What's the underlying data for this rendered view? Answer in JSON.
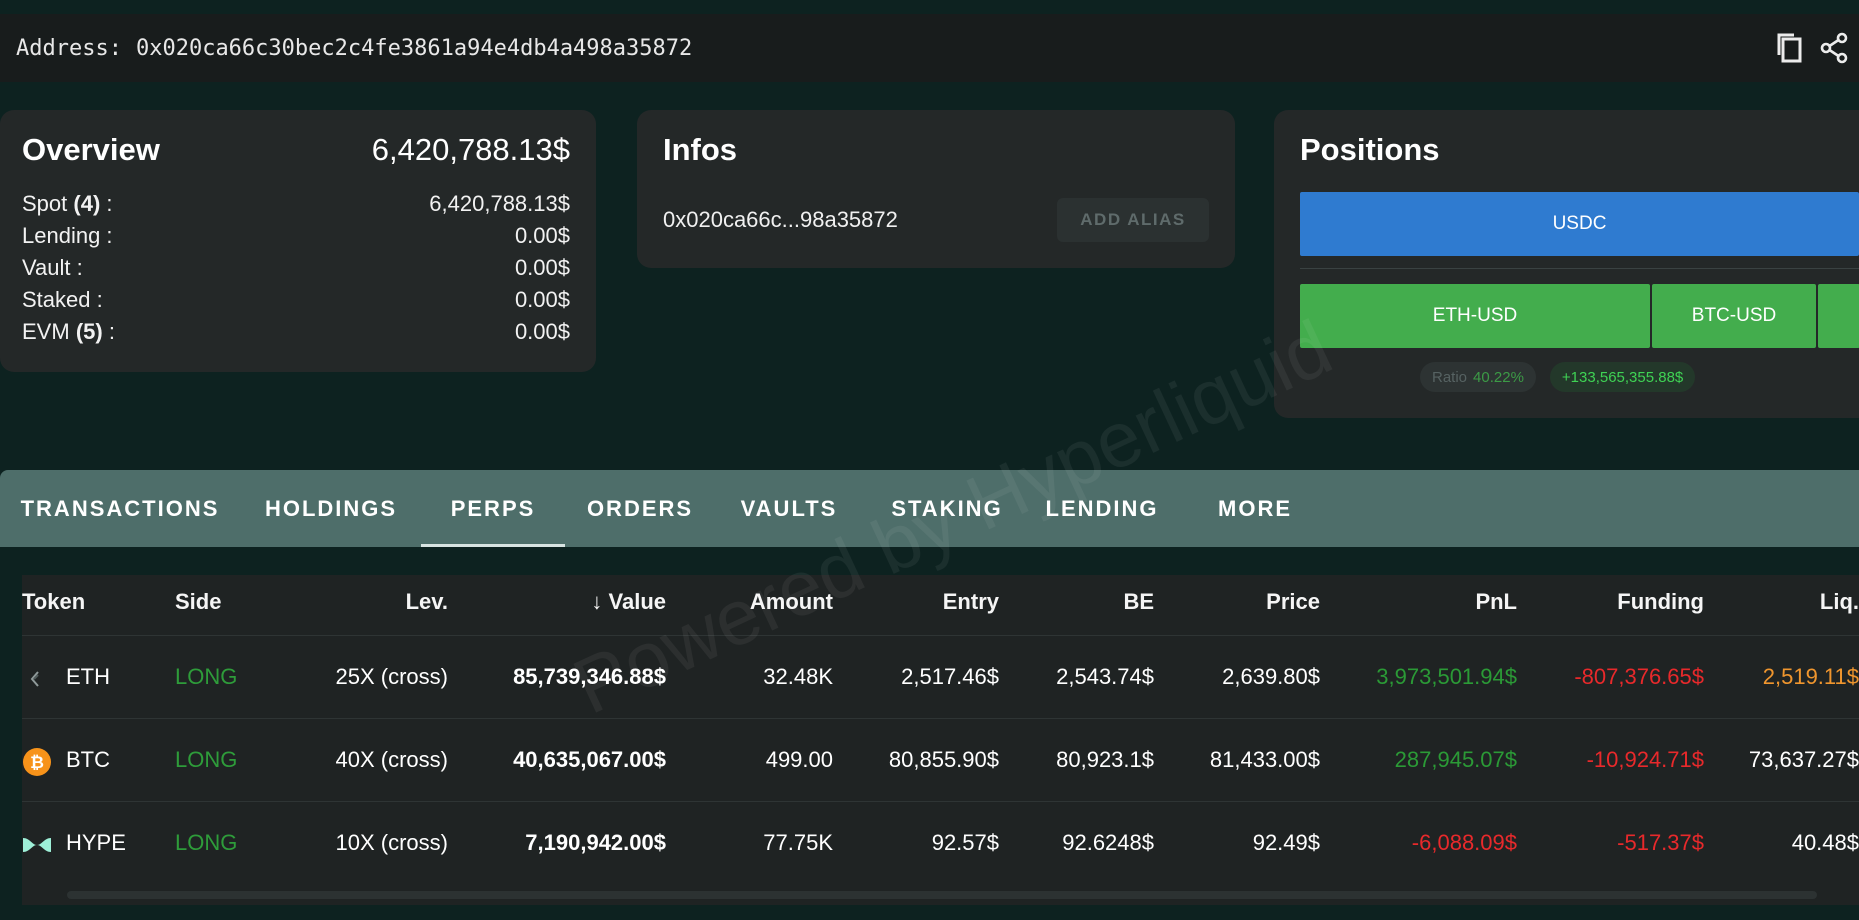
{
  "address_bar": {
    "label": "Address:",
    "value": "0x020ca66c30bec2c4fe3861a94e4db4a498a35872",
    "copy_icon": "copy-icon",
    "share_icon": "share-icon"
  },
  "overview": {
    "title": "Overview",
    "total": "6,420,788.13$",
    "rows": [
      {
        "label": "Spot",
        "count": "(4)",
        "suffix": " :",
        "value": "6,420,788.13$"
      },
      {
        "label": "Lending :",
        "count": "",
        "suffix": "",
        "value": "0.00$"
      },
      {
        "label": "Vault :",
        "count": "",
        "suffix": "",
        "value": "0.00$"
      },
      {
        "label": "Staked :",
        "count": "",
        "suffix": "",
        "value": "0.00$"
      },
      {
        "label": "EVM",
        "count": "(5)",
        "suffix": " :",
        "value": "0.00$"
      }
    ]
  },
  "infos": {
    "title": "Infos",
    "short_address": "0x020ca66c...98a35872",
    "add_alias_label": "ADD ALIAS"
  },
  "positions": {
    "title": "Positions",
    "top_bar": {
      "label": "USDC",
      "color": "#2f7bd0"
    },
    "bottom_bars": [
      {
        "label": "ETH-USD",
        "color": "#43ad4d"
      },
      {
        "label": "BTC-USD",
        "color": "#43ad4d"
      },
      {
        "label": "",
        "color": "#43ad4d"
      }
    ],
    "ratio_label": "Ratio",
    "ratio_value": "40.22%",
    "pnl_badge": "+133,565,355.88$"
  },
  "tabs": [
    {
      "label": "TRANSACTIONS",
      "active": false
    },
    {
      "label": "HOLDINGS",
      "active": false
    },
    {
      "label": "PERPS",
      "active": true
    },
    {
      "label": "ORDERS",
      "active": false
    },
    {
      "label": "VAULTS",
      "active": false
    },
    {
      "label": "STAKING",
      "active": false
    },
    {
      "label": "LENDING",
      "active": false
    },
    {
      "label": "MORE",
      "active": false
    }
  ],
  "table": {
    "headers": {
      "token": "Token",
      "side": "Side",
      "lev": "Lev.",
      "value_arrow": "↓",
      "value": "Value",
      "amount": "Amount",
      "entry": "Entry",
      "be": "BE",
      "price": "Price",
      "pnl": "PnL",
      "funding": "Funding",
      "liq": "Liq."
    },
    "rows": [
      {
        "icon": "eth-icon",
        "token": "ETH",
        "side": "LONG",
        "lev": "25X (cross)",
        "value": "85,739,346.88$",
        "amount": "32.48K",
        "entry": "2,517.46$",
        "be": "2,543.74$",
        "price": "2,639.80$",
        "pnl": "3,973,501.94$",
        "pnl_sign": "pos",
        "funding": "-807,376.65$",
        "liq": "2,519.11$",
        "liq_warn": true
      },
      {
        "icon": "btc-icon",
        "token": "BTC",
        "side": "LONG",
        "lev": "40X (cross)",
        "value": "40,635,067.00$",
        "amount": "499.00",
        "entry": "80,855.90$",
        "be": "80,923.1$",
        "price": "81,433.00$",
        "pnl": "287,945.07$",
        "pnl_sign": "pos",
        "funding": "-10,924.71$",
        "liq": "73,637.27$",
        "liq_warn": false
      },
      {
        "icon": "hype-icon",
        "token": "HYPE",
        "side": "LONG",
        "lev": "10X (cross)",
        "value": "7,190,942.00$",
        "amount": "77.75K",
        "entry": "92.57$",
        "be": "92.6248$",
        "price": "92.49$",
        "pnl": "-6,088.09$",
        "pnl_sign": "neg",
        "funding": "-517.37$",
        "liq": "40.48$",
        "liq_warn": false
      }
    ]
  },
  "watermark": "Powered by Hyperliquid"
}
